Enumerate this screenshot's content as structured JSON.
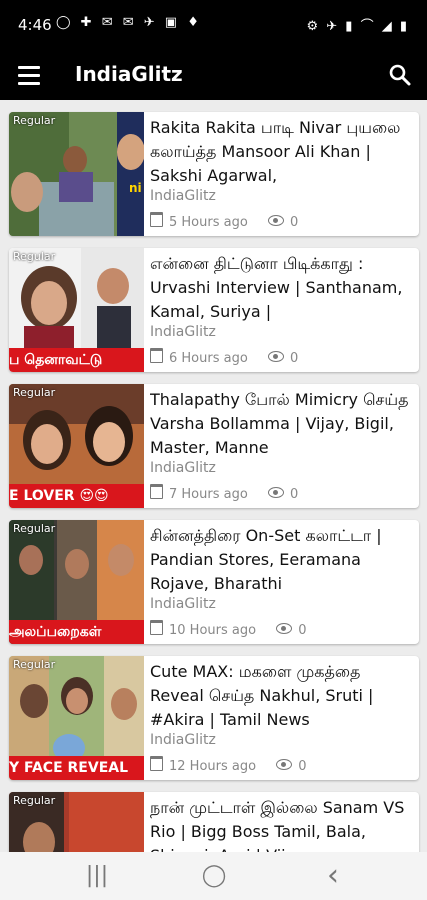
{
  "status": {
    "time": "4:46",
    "left_icons": "◯ ✚ ✉ ✉ ✈ ▣ ♦",
    "right_icons": "⚙ ✈ ▮ ⌒ ◢ ▮"
  },
  "app": {
    "title": "IndiaGlitz"
  },
  "icons": {
    "menu": "hamburger-menu-icon",
    "search": "search-icon",
    "calendar": "calendar-icon",
    "views": "eye-icon"
  },
  "articles": [
    {
      "tag": "Regular",
      "title": "Rakita Rakita பாடி Nivar புயலை கலாய்த்த Mansoor Ali Khan | Sakshi Agarwal,",
      "source": "IndiaGlitz",
      "time": "5 Hours ago",
      "views": "0",
      "caption": ""
    },
    {
      "tag": "Regular",
      "title": "என்னை திட்டுனா பிடிக்காது : Urvashi Interview | Santhanam, Kamal, Suriya |",
      "source": "IndiaGlitz",
      "time": "6 Hours ago",
      "views": "0",
      "caption": "ப தெனாவட்டு"
    },
    {
      "tag": "Regular",
      "title": "Thalapathy போல் Mimicry செய்த Varsha Bollamma | Vijay, Bigil, Master, Manne",
      "source": "IndiaGlitz",
      "time": "7 Hours ago",
      "views": "0",
      "caption": "E LOVER 😍😍"
    },
    {
      "tag": "Regular",
      "title": "சின்னத்திரை On-Set கலாட்டா | Pandian Stores, Eeramana Rojave, Bharathi",
      "source": "IndiaGlitz",
      "time": "10 Hours ago",
      "views": "0",
      "caption": "அலப்பறைகள்"
    },
    {
      "tag": "Regular",
      "title": " Cute MAX: மகளை முகத்தை Reveal செய்த Nakhul, Sruti | #Akira | Tamil News",
      "source": "IndiaGlitz",
      "time": "12 Hours ago",
      "views": "0",
      "caption": "Y FACE REVEAL"
    },
    {
      "tag": "Regular",
      "title": "நான் முட்டாள் இல்லை Sanam VS Rio | Bigg Boss Tamil, Bala, Shivani, Aari | Vijay",
      "source": "IndiaGlitz",
      "time": "",
      "views": "",
      "caption": ""
    }
  ],
  "nav": {
    "recents": "|||",
    "home": "◯",
    "back": "‹"
  }
}
